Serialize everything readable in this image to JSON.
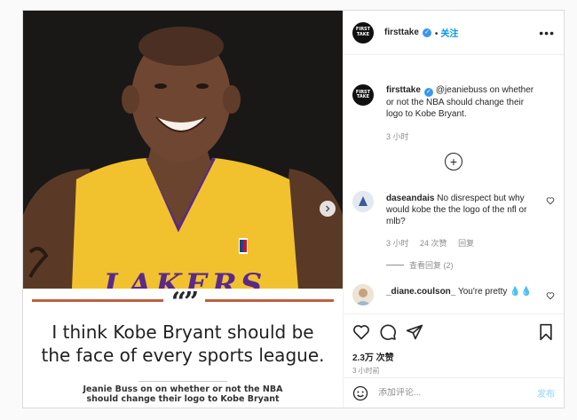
{
  "post": {
    "author": "firsttake",
    "avatar_text": "FIRST TAKE",
    "follow_label": "关注",
    "more_label": "•••"
  },
  "media": {
    "jersey_text": "LAKERS",
    "quote_marks": "“”",
    "headline_line1": "I think Kobe Bryant should be",
    "headline_line2": "the face of every sports league.",
    "caption_line1": "Jeanie Buss on on whether or not the NBA",
    "caption_line2": "should change their logo to Kobe Bryant"
  },
  "caption_comment": {
    "user": "firsttake",
    "text": "@jeaniebuss on whether or not the NBA should change their logo to Kobe Bryant.",
    "time": "3 小时"
  },
  "comments": [
    {
      "user": "daseandais",
      "text": "No disrespect but why would kobe the the logo of the nfl or mlb?",
      "time": "3 小时",
      "likes": "24 次赞",
      "reply_label": "回复",
      "view_replies": "查看回复 (2)"
    },
    {
      "user": "_diane.coulson_",
      "text": "You're pretty 💧💧"
    }
  ],
  "likes_count": "2.3万 次赞",
  "post_time": "3 小时前",
  "composer": {
    "placeholder": "添加评论...",
    "post_label": "发布"
  },
  "icons": [
    "heart-icon",
    "comment-icon",
    "share-icon",
    "bookmark-icon",
    "emoji-icon",
    "plus-circle-icon",
    "chevron-right-icon",
    "verified-icon"
  ],
  "colors": {
    "accent": "#0095f6",
    "jersey": "#f2c12e",
    "rule": "#c0603f"
  }
}
